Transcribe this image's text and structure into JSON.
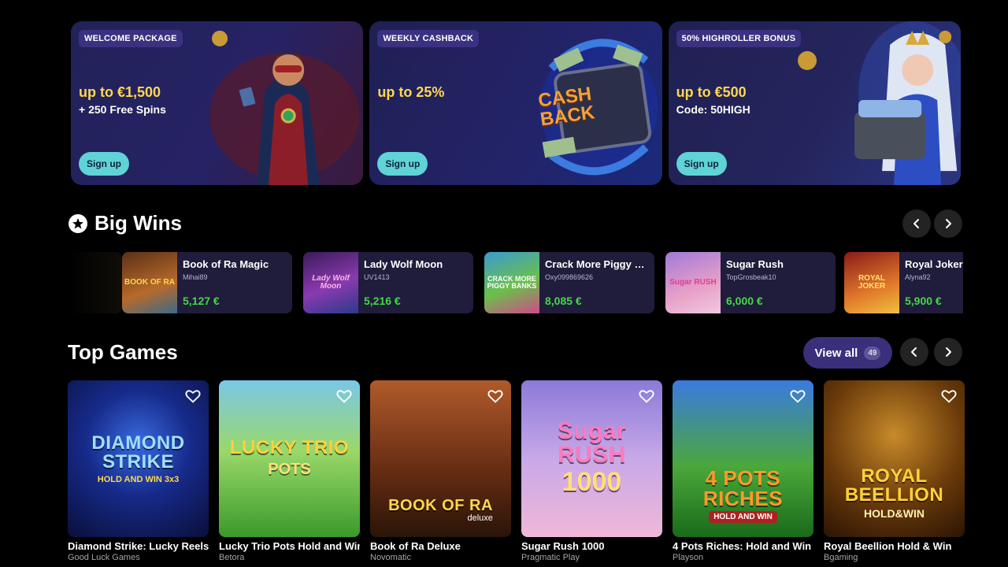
{
  "promos": [
    {
      "badge": "WELCOME PACKAGE",
      "headline": "up to €1,500",
      "subline": "+ 250 Free Spins",
      "cta": "Sign up"
    },
    {
      "badge": "WEEKLY CASHBACK",
      "headline": "up to 25%",
      "subline": "",
      "cta": "Sign up",
      "art_text": "CASH BACK"
    },
    {
      "badge": "50% HIGHROLLER BONUS",
      "headline": "up to €500",
      "subline": "Code: 50HIGH",
      "cta": "Sign up"
    }
  ],
  "big_wins": {
    "title": "Big Wins",
    "items": [
      {
        "game": "Book of Ra Magic",
        "user": "Mihai89",
        "amount": "5,127 €",
        "thumb_text": "BOOK OF RA"
      },
      {
        "game": "Lady Wolf Moon",
        "user": "UV1413",
        "amount": "5,216 €",
        "thumb_text": "Lady Wolf Moon"
      },
      {
        "game": "Crack More Piggy Ba...",
        "user": "Oxy099869626",
        "amount": "8,085 €",
        "thumb_text": "CRACK MORE PIGGY BANKS"
      },
      {
        "game": "Sugar Rush",
        "user": "TopGrosbeak10",
        "amount": "6,000 €",
        "thumb_text": "Sugar RUSH"
      },
      {
        "game": "Royal Joker:",
        "user": "Alyna92",
        "amount": "5,900 €",
        "thumb_text": "ROYAL JOKER"
      }
    ]
  },
  "top_games": {
    "title": "Top Games",
    "view_all": "View all",
    "count": "49",
    "items": [
      {
        "name": "Diamond Strike: Lucky Reels",
        "provider": "Good Luck Games",
        "tile_text": "DIAMOND STRIKE",
        "tile_sub": "HOLD AND WIN 3x3"
      },
      {
        "name": "Lucky Trio Pots Hold and Win",
        "provider": "Betora",
        "tile_text": "LUCKY TRIO",
        "tile_sub": "POTS"
      },
      {
        "name": "Book of Ra Deluxe",
        "provider": "Novomatic",
        "tile_text": "BOOK OF RA",
        "tile_sub": "deluxe"
      },
      {
        "name": "Sugar Rush 1000",
        "provider": "Pragmatic Play",
        "tile_text": "Sugar RUSH",
        "tile_sub": "1000"
      },
      {
        "name": "4 Pots Riches: Hold and Win",
        "provider": "Playson",
        "tile_text": "4 POTS RICHES",
        "tile_sub": "HOLD AND WIN"
      },
      {
        "name": "Royal Beellion Hold & Win",
        "provider": "Bgaming",
        "tile_text": "ROYAL BEELLION",
        "tile_sub": "HOLD&WIN"
      }
    ]
  },
  "icons": {
    "star": "star-circle-icon",
    "prev": "chevron-left-icon",
    "next": "chevron-right-icon",
    "fav": "heart-outline-icon"
  },
  "colors": {
    "accent_yellow": "#ffd84d",
    "win_green": "#46d64a",
    "signup_teal": "#5fd3d6",
    "view_all_purple": "#3a2f7a"
  }
}
